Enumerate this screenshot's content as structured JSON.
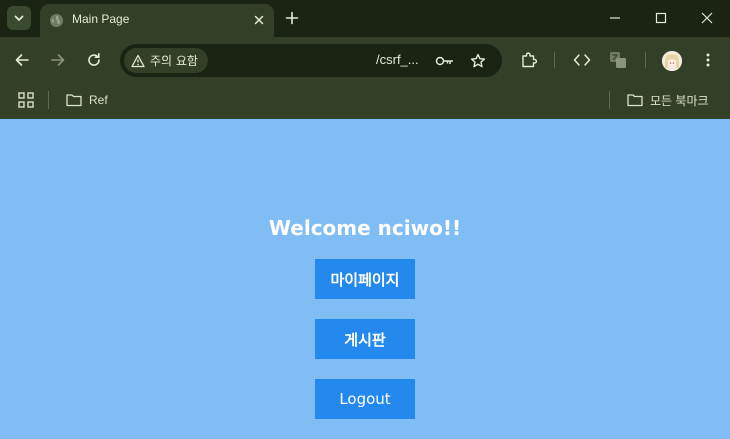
{
  "browser": {
    "tab_title": "Main Page",
    "security_chip": "주의 요함",
    "url": "/csrf_...",
    "bookmarks": [
      {
        "label": "Ref"
      }
    ],
    "all_bookmarks_label": "모든 북마크",
    "icons": [
      "tab-search-icon",
      "globe-icon",
      "close-icon",
      "plus-icon",
      "minimize-icon",
      "maximize-icon",
      "close-window-icon",
      "back-arrow-icon",
      "forward-arrow-icon",
      "reload-icon",
      "warning-icon",
      "key-icon",
      "star-icon",
      "extensions-icon",
      "code-icon",
      "translate-icon",
      "avatar",
      "more-vert-icon",
      "apps-grid-icon",
      "folder-icon"
    ]
  },
  "page": {
    "welcome": "Welcome nciwo!!",
    "buttons": {
      "mypage": "마이페이지",
      "board": "게시판",
      "logout": "Logout"
    },
    "colors": {
      "background": "#80bdf5",
      "button": "#2389ee",
      "text": "#ffffff"
    }
  }
}
